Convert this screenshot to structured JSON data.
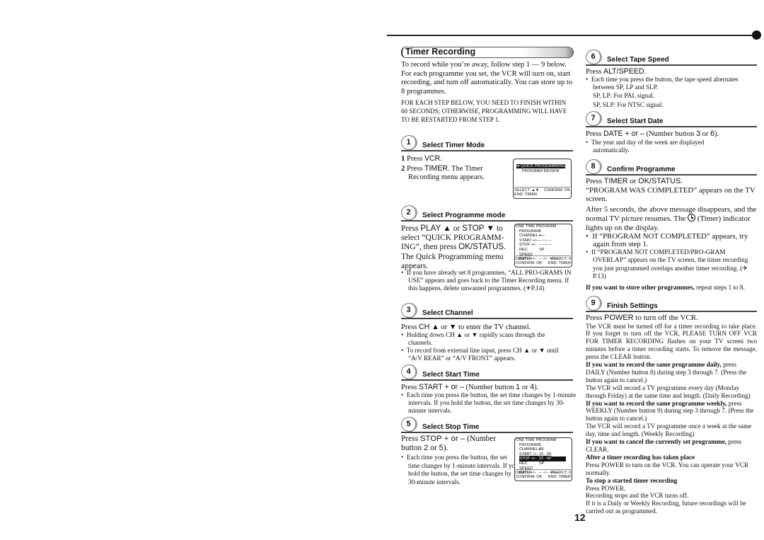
{
  "page": {
    "title": "Timer Recording",
    "page_number": "12"
  },
  "intro": {
    "paragraph": "To record while you’re away, follow step 1 — 9 below. For each programme you set, the VCR will turn on, start recording, and turn off automatically. You can store up to 8 programmes.",
    "warning": "FOR EACH STEP BELOW, YOU NEED TO FINISH WITHIN 60 SECONDS; OTHERWISE, PROGRAMMING WILL HAVE TO BE RESTARTED FROM STEP 1."
  },
  "steps": [
    {
      "number": "1",
      "title": "Select Timer Mode",
      "lines": [
        {
          "n": "1",
          "pre": "Press ",
          "key": "VCR",
          "post": "."
        },
        {
          "n": "2",
          "pre": "Press ",
          "key": "TIMER",
          "post": ". The Timer Recording menu appears."
        }
      ],
      "screen": {
        "items": [
          "➡ QUICK PROGRAMMING",
          "PROGRAM  REVIEW"
        ],
        "footer_left": "SELECT: ▲▼",
        "footer_right": "CONFIRM: OK",
        "footer_line2": "END: TIMER"
      }
    },
    {
      "number": "2",
      "title": "Select Programme mode",
      "text_parts": {
        "a": "Press ",
        "k1": "PLAY ▲",
        "b": " or ",
        "k2": "STOP ▼",
        "c": " to select “QUICK PROGRAMM-ING”, then press ",
        "k3": "OK/STATUS",
        "d": ". The Quick Programming menu appears."
      },
      "bullets": [
        "If you have already set 8 programmes, “ALL PRO-GRAMS IN USE” appears and goes back to the Timer Recording menu. If this happens, delete unwanted programmes. (✈P.14)"
      ],
      "screen": {
        "header": "ONE TIME PROGRAM",
        "rows": [
          {
            "k": "PROGRAM",
            "v": "1"
          },
          {
            "k": "CHANNEL+/–",
            "v": "– –"
          },
          {
            "k": "START +/–",
            "v": "– –:– –"
          },
          {
            "k": "STOP +/–",
            "v": "– –:– –"
          },
          {
            "k": "REC SPEED",
            "v": "SP"
          },
          {
            "k": "DATE +/–",
            "v": "– –/– –/– –"
          }
        ],
        "footer_left": "DAILY: 8",
        "footer_right": "WEEKLY: 9",
        "footer_left2": "CONFIRM: OK",
        "footer_right2": "END: TIMER"
      }
    },
    {
      "number": "3",
      "title": "Select Channel",
      "text_parts": {
        "a": "Press ",
        "k1": "CH ▲",
        "b": " or ",
        "k2": "▼",
        "c": " to enter the TV channel."
      },
      "bullets": [
        "Holding down CH ▲ or ▼ rapidly scans through the channels.",
        "To record from external line input, press CH ▲ or ▼ until “A/V REAR” or “A/V FRONT” appears."
      ]
    },
    {
      "number": "4",
      "title": "Select Start Time",
      "text_parts": {
        "a": "Press ",
        "k1": "START + or –",
        "b": " (Number button ",
        "k2": "1",
        "c": " or ",
        "k3": "4",
        "d": ")."
      },
      "bullets": [
        "Each time you press the button, the set time changes by 1-minute intervals. If you hold the button, the set time changes by 30-minute intervals."
      ]
    },
    {
      "number": "5",
      "title": "Select Stop Time",
      "text_parts": {
        "a": "Press ",
        "k1": "STOP + or –",
        "b": " (Number button ",
        "k2": "2",
        "c": " or ",
        "k3": "5",
        "d": ")."
      },
      "bullets": [
        "Each time you press the button, the set time changes by 1-minute intervals. If you hold the button, the set time changes by 30-minute intervals."
      ],
      "screen": {
        "header": "ONE TIME PROGRAM",
        "rows": [
          {
            "k": "PROGRAM",
            "v": "1"
          },
          {
            "k": "CHANNEL+/–",
            "v": "12"
          },
          {
            "k": "START +/–",
            "v": "20 : 00"
          },
          {
            "k": "STOP +/–",
            "v": "22 : 00"
          },
          {
            "k": "REC SPEED",
            "v": "SP"
          },
          {
            "k": "DATE +/–",
            "v": "– –/– –/– –"
          }
        ],
        "highlight_row": "STOP +/–",
        "footer_left": "DAILY: 8",
        "footer_right": "WEEKLY: 9",
        "footer_left2": "CONFIRM: OK",
        "footer_right2": "END: TIMER"
      }
    },
    {
      "number": "6",
      "title": "Select Tape Speed",
      "text_parts": {
        "a": "Press ",
        "k1": "ALT/SPEED",
        "b": "."
      },
      "bullets": [
        "Each time you press the button, the tape speed alternates between SP, LP and SLP."
      ],
      "notes": [
        "SP, LP: For PAL signal.",
        "SP, SLP: For NTSC signal."
      ]
    },
    {
      "number": "7",
      "title": "Select Start Date",
      "text_parts": {
        "a": "Press ",
        "k1": "DATE + or –",
        "b": " (Number button ",
        "k2": "3",
        "c": " or ",
        "k3": "6",
        "d": ")."
      },
      "bullets": [
        "The year and day of the week are displayed automatically."
      ]
    },
    {
      "number": "8",
      "title": "Confirm Programme",
      "text_parts": {
        "a": "Press ",
        "k1": "TIMER",
        "b": " or ",
        "k2": "OK/STATUS",
        "c": "."
      },
      "para1": "“PROGRAM WAS COMPLETED” appears on the TV screen.",
      "para2_a": "After 5 seconds, the above message disappears, and the normal TV picture  resumes. The ",
      "para2_icon": "timer-icon",
      "para2_b": " (Timer) indicator lights up on the display.",
      "bullets": [
        "If “PROGRAM NOT COMPLETED” appears, try again from step 1.",
        "If “PROGRAM NOT COMPLETED/PRO-GRAM OVERLAP” appears on the TV screen, the timer recording you just programmed overlaps another timer recording. (✈P.13)"
      ],
      "store_bold": "If you want to store other programmes,",
      "store_rest": " repeat steps 1 to 8."
    },
    {
      "number": "9",
      "title": "Finish Settings",
      "text_parts": {
        "a": "Press ",
        "k1": "POWER",
        "b": " to turn off the VCR."
      },
      "body": "The VCR must be turned off for a timer recording to take place. If you forget to turn off the VCR, PLEASE TURN OFF VCR FOR TIMER RECORDING flashes on your TV screen two minutes before a timer recording starts. To remove the message, press the CLEAR button.",
      "daily_bold": "If you want to record the same programme daily,",
      "daily_rest": " press DAILY (Number button 8) during step 3 through 7. (Press the button again to cancel.)",
      "daily_desc": "The VCR will record a TV programme every day (Monday through Friday) at the same time and length. (Daily Recording)",
      "weekly_bold": "If you want to record the same programme weekly,",
      "weekly_rest": " press WEEKLY (Number button 9) during step 3 through 7. (Press the button again to cancel.)",
      "weekly_desc": "The VCR will record a TV programme once a week at the same day, time and length. (Weekly Recording)",
      "cancel_bold": "If you want to cancel the currently set programme,",
      "cancel_rest": " press CLEAR.",
      "after_bold": "After a timer recording has taken place",
      "after_text": "Press POWER to turn on the VCR. You can operate your VCR normally.",
      "stop_bold": "To stop a started timer recording",
      "stop_text1": "Press POWER.",
      "stop_text2": "Recording stops and the VCR turns off.",
      "stop_text3": "If it is a Daily or Weekly Recording, future recordings will be carried out as programmed."
    }
  ]
}
